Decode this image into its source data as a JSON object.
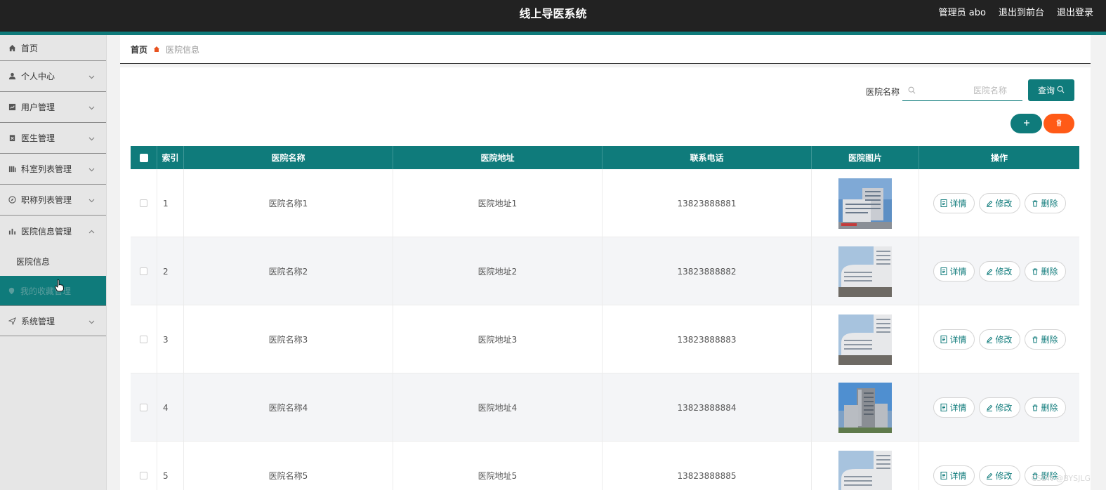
{
  "header": {
    "title": "线上导医系统",
    "user": "管理员 abo",
    "to_front": "退出到前台",
    "logout": "退出登录"
  },
  "sidebar": {
    "items": [
      {
        "label": "首页",
        "icon": "home-icon"
      },
      {
        "label": "个人中心",
        "icon": "user-icon"
      },
      {
        "label": "用户管理",
        "icon": "chart-icon"
      },
      {
        "label": "医生管理",
        "icon": "clipboard-icon"
      },
      {
        "label": "科室列表管理",
        "icon": "bars-icon"
      },
      {
        "label": "职称列表管理",
        "icon": "compass-icon"
      },
      {
        "label": "医院信息管理",
        "icon": "stats-icon"
      },
      {
        "label": "系统管理",
        "icon": "send-icon"
      }
    ],
    "sub_items": [
      {
        "label": "医院信息"
      },
      {
        "label": "我的收藏管理",
        "icon": "location-icon"
      }
    ]
  },
  "breadcrumb": {
    "home": "首页",
    "current": "医院信息"
  },
  "search": {
    "label": "医院名称",
    "placeholder": "医院名称",
    "button": "查询"
  },
  "table": {
    "columns": [
      "索引",
      "医院名称",
      "医院地址",
      "联系电话",
      "医院图片",
      "操作"
    ],
    "rows": [
      {
        "index": "1",
        "name": "医院名称1",
        "address": "医院地址1",
        "phone": "13823888881"
      },
      {
        "index": "2",
        "name": "医院名称2",
        "address": "医院地址2",
        "phone": "13823888882"
      },
      {
        "index": "3",
        "name": "医院名称3",
        "address": "医院地址3",
        "phone": "13823888883"
      },
      {
        "index": "4",
        "name": "医院名称4",
        "address": "医院地址4",
        "phone": "13823888884"
      },
      {
        "index": "5",
        "name": "医院名称5",
        "address": "医院地址5",
        "phone": "13823888885"
      }
    ],
    "actions": {
      "detail": "详情",
      "edit": "修改",
      "delete": "删除"
    }
  },
  "watermark": "CSDN @BYSJLG",
  "colors": {
    "primary": "#0f7b7b",
    "header": "#222222",
    "danger": "#ff5a17"
  }
}
